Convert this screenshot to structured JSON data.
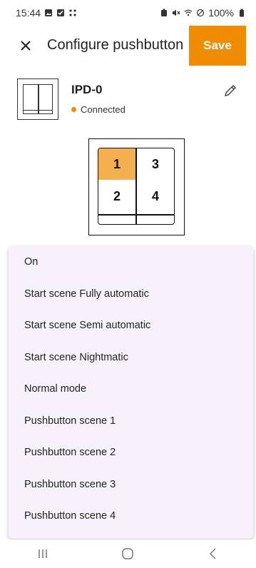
{
  "status_bar": {
    "time": "15:44",
    "battery": "100%",
    "icons_left": [
      "image-icon",
      "check-square-icon",
      "slack-icon"
    ],
    "icons_right": [
      "battery-saver-icon",
      "mute-icon",
      "wifi-icon",
      "no-disturb-icon",
      "battery-icon"
    ]
  },
  "toolbar": {
    "title": "Configure pushbutton",
    "save_label": "Save",
    "close_icon": "close-icon"
  },
  "device": {
    "name": "IPD-0",
    "status": "Connected",
    "status_color": "#f08c00",
    "edit_icon": "pencil-icon"
  },
  "switch": {
    "buttons": [
      {
        "label": "1",
        "selected": true
      },
      {
        "label": "3",
        "selected": false
      },
      {
        "label": "2",
        "selected": false
      },
      {
        "label": "4",
        "selected": false
      }
    ],
    "selected_color": "#f4b04e"
  },
  "menu": {
    "items": [
      "On",
      "Start scene Fully automatic",
      "Start scene Semi automatic",
      "Start scene Nightmatic",
      "Normal mode",
      "Pushbutton scene 1",
      "Pushbutton scene 2",
      "Pushbutton scene 3",
      "Pushbutton scene 4"
    ]
  },
  "nav": {
    "buttons": [
      "recents-icon",
      "home-icon",
      "back-icon"
    ]
  },
  "colors": {
    "accent": "#f08c00",
    "menu_bg": "#f7f1fb"
  }
}
